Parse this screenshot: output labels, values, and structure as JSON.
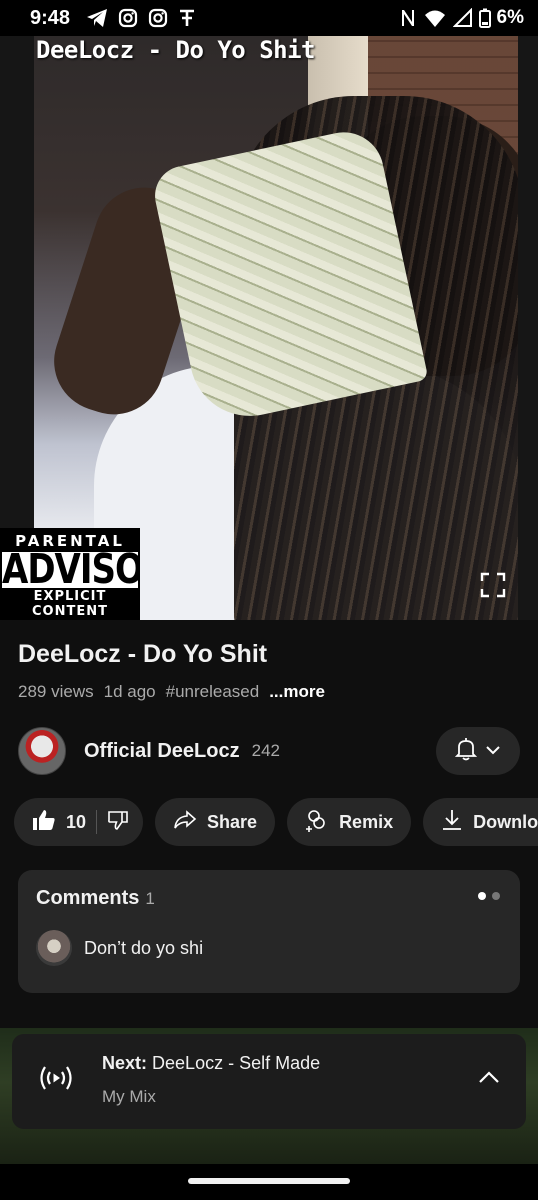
{
  "status_bar": {
    "time": "9:48",
    "battery": "6%",
    "icons": [
      "telegram-icon",
      "instagram-icon",
      "instagram-icon",
      "t-app-icon",
      "nfc-icon",
      "wifi-icon",
      "signal-icon",
      "battery-icon"
    ]
  },
  "player": {
    "overlay_title": "DeeLocz - Do Yo Shit",
    "advisory": {
      "line1": "PARENTAL",
      "line2": "ADVISORY",
      "line3": "EXPLICIT CONTENT"
    }
  },
  "video": {
    "title": "DeeLocz - Do Yo Shit",
    "views": "289 views",
    "age": "1d ago",
    "hashtag": "#unreleased",
    "more": "...more"
  },
  "channel": {
    "name": "Official DeeLocz",
    "subscribers": "242"
  },
  "actions": {
    "like_count": "10",
    "share": "Share",
    "remix": "Remix",
    "download": "Download"
  },
  "comments": {
    "label": "Comments",
    "count": "1",
    "top_comment": "Don’t do yo shi"
  },
  "next_up": {
    "prefix": "Next:",
    "title": "DeeLocz - Self Made",
    "playlist": "My Mix"
  },
  "colors": {
    "background": "#0f0f0f",
    "surface": "#272727",
    "text": "#f1f1f1",
    "secondary_text": "#aaaaaa"
  }
}
